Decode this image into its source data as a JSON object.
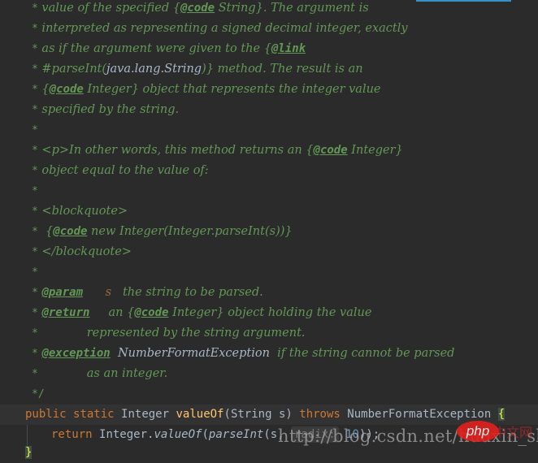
{
  "editor": {
    "colors": {
      "background": "#2b2b2b",
      "doc_comment": "#629755",
      "keyword": "#cc7832",
      "identifier": "#a9b7c6",
      "method_decl": "#ffc66d",
      "number": "#6897bb",
      "param_name": "#a0693a",
      "tab_indicator": "#3592c4"
    },
    "doc_lines": [
      {
        "star": "*",
        "parts": [
          {
            "t": "text",
            "v": " value of the specified "
          },
          {
            "t": "brace",
            "v": "{"
          },
          {
            "t": "tag",
            "v": "@code"
          },
          {
            "t": "text",
            "v": " String}. The argument is"
          }
        ]
      },
      {
        "star": "*",
        "parts": [
          {
            "t": "text",
            "v": " interpreted as representing a signed decimal integer, exactly"
          }
        ]
      },
      {
        "star": "*",
        "parts": [
          {
            "t": "text",
            "v": " as if the argument were given to the "
          },
          {
            "t": "brace",
            "v": "{"
          },
          {
            "t": "tag",
            "v": "@link"
          }
        ]
      },
      {
        "star": "*",
        "parts": [
          {
            "t": "text",
            "v": " #parseInt("
          },
          {
            "t": "ref",
            "v": "java.lang.String"
          },
          {
            "t": "text",
            "v": ")} method. The result is an"
          }
        ]
      },
      {
        "star": "*",
        "parts": [
          {
            "t": "text",
            "v": " {"
          },
          {
            "t": "tag",
            "v": "@code"
          },
          {
            "t": "text",
            "v": " Integer} object that represents the integer value"
          }
        ]
      },
      {
        "star": "*",
        "parts": [
          {
            "t": "text",
            "v": " specified by the string."
          }
        ]
      },
      {
        "star": "*",
        "parts": []
      },
      {
        "star": "*",
        "parts": [
          {
            "t": "text",
            "v": " <p>In other words, this method returns an {"
          },
          {
            "t": "tag",
            "v": "@code"
          },
          {
            "t": "text",
            "v": " Integer}"
          }
        ]
      },
      {
        "star": "*",
        "parts": [
          {
            "t": "text",
            "v": " object equal to the value of:"
          }
        ]
      },
      {
        "star": "*",
        "parts": []
      },
      {
        "star": "*",
        "parts": [
          {
            "t": "text",
            "v": " <blockquote>"
          }
        ]
      },
      {
        "star": "*",
        "parts": [
          {
            "t": "text",
            "v": "  {"
          },
          {
            "t": "tag",
            "v": "@code"
          },
          {
            "t": "text",
            "v": " new Integer(Integer.parseInt(s))}"
          }
        ]
      },
      {
        "star": "*",
        "parts": [
          {
            "t": "text",
            "v": " </blockquote>"
          }
        ]
      },
      {
        "star": "*",
        "parts": []
      },
      {
        "star": "*",
        "parts": [
          {
            "t": "text",
            "v": " "
          },
          {
            "t": "tag",
            "v": "@param"
          },
          {
            "t": "text",
            "v": "      "
          },
          {
            "t": "param",
            "v": "s"
          },
          {
            "t": "text",
            "v": "   the string to be parsed."
          }
        ]
      },
      {
        "star": "*",
        "parts": [
          {
            "t": "text",
            "v": " "
          },
          {
            "t": "tag",
            "v": "@return"
          },
          {
            "t": "text",
            "v": "     an {"
          },
          {
            "t": "tag",
            "v": "@code"
          },
          {
            "t": "text",
            "v": " Integer} object holding the value"
          }
        ]
      },
      {
        "star": "*",
        "parts": [
          {
            "t": "text",
            "v": "             represented by the string argument."
          }
        ]
      },
      {
        "star": "*",
        "parts": [
          {
            "t": "text",
            "v": " "
          },
          {
            "t": "tag",
            "v": "@exception"
          },
          {
            "t": "text",
            "v": "  "
          },
          {
            "t": "ref",
            "v": "NumberFormatException"
          },
          {
            "t": "text",
            "v": "  if the string cannot be parsed"
          }
        ]
      },
      {
        "star": "*",
        "parts": [
          {
            "t": "text",
            "v": "             as an integer."
          }
        ]
      },
      {
        "star": "*/",
        "parts": []
      }
    ],
    "code": {
      "signature": {
        "kw_public": "public",
        "kw_static": "static",
        "return_type": "Integer",
        "method_name": "valueOf",
        "open_paren": "(",
        "param_type": "String",
        "param_name": "s",
        "close_paren": ")",
        "kw_throws": "throws",
        "exception": "NumberFormatException",
        "open_brace": "{"
      },
      "body": {
        "kw_return": "return",
        "class_ref": "Integer.",
        "call": "valueOf",
        "paren_open": "(",
        "inner_call": "parseInt",
        "args_start": "(s,",
        "hint": "radix:",
        "number": "10",
        "args_end": "));"
      },
      "close_brace": "}"
    }
  },
  "watermark": {
    "text": "http://blog.csdn.net/huaxin_sky",
    "logo_text": "php",
    "logo_cn": "中文网"
  }
}
